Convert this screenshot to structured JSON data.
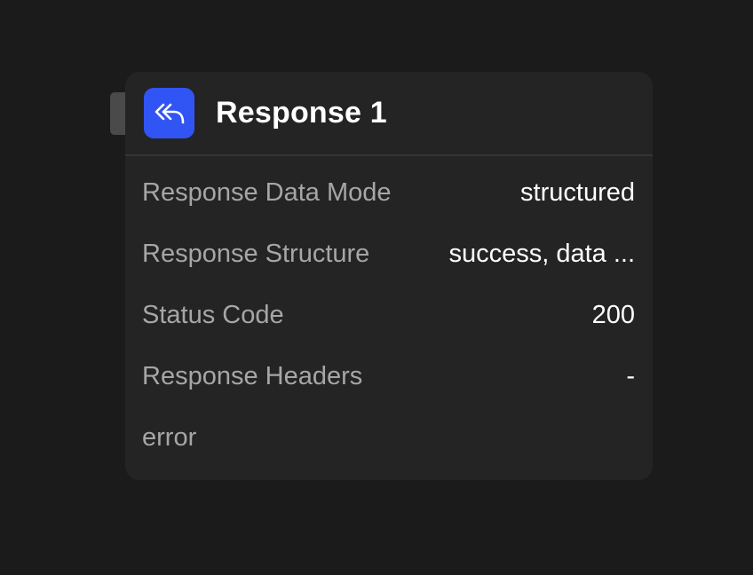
{
  "node": {
    "title": "Response 1",
    "icon": "reply-all-icon",
    "accent_color": "#3154f5",
    "rows": [
      {
        "label": "Response Data Mode",
        "value": "structured"
      },
      {
        "label": "Response Structure",
        "value": "success, data ..."
      },
      {
        "label": "Status Code",
        "value": "200"
      },
      {
        "label": "Response Headers",
        "value": "-"
      },
      {
        "label": "error",
        "value": ""
      }
    ]
  }
}
